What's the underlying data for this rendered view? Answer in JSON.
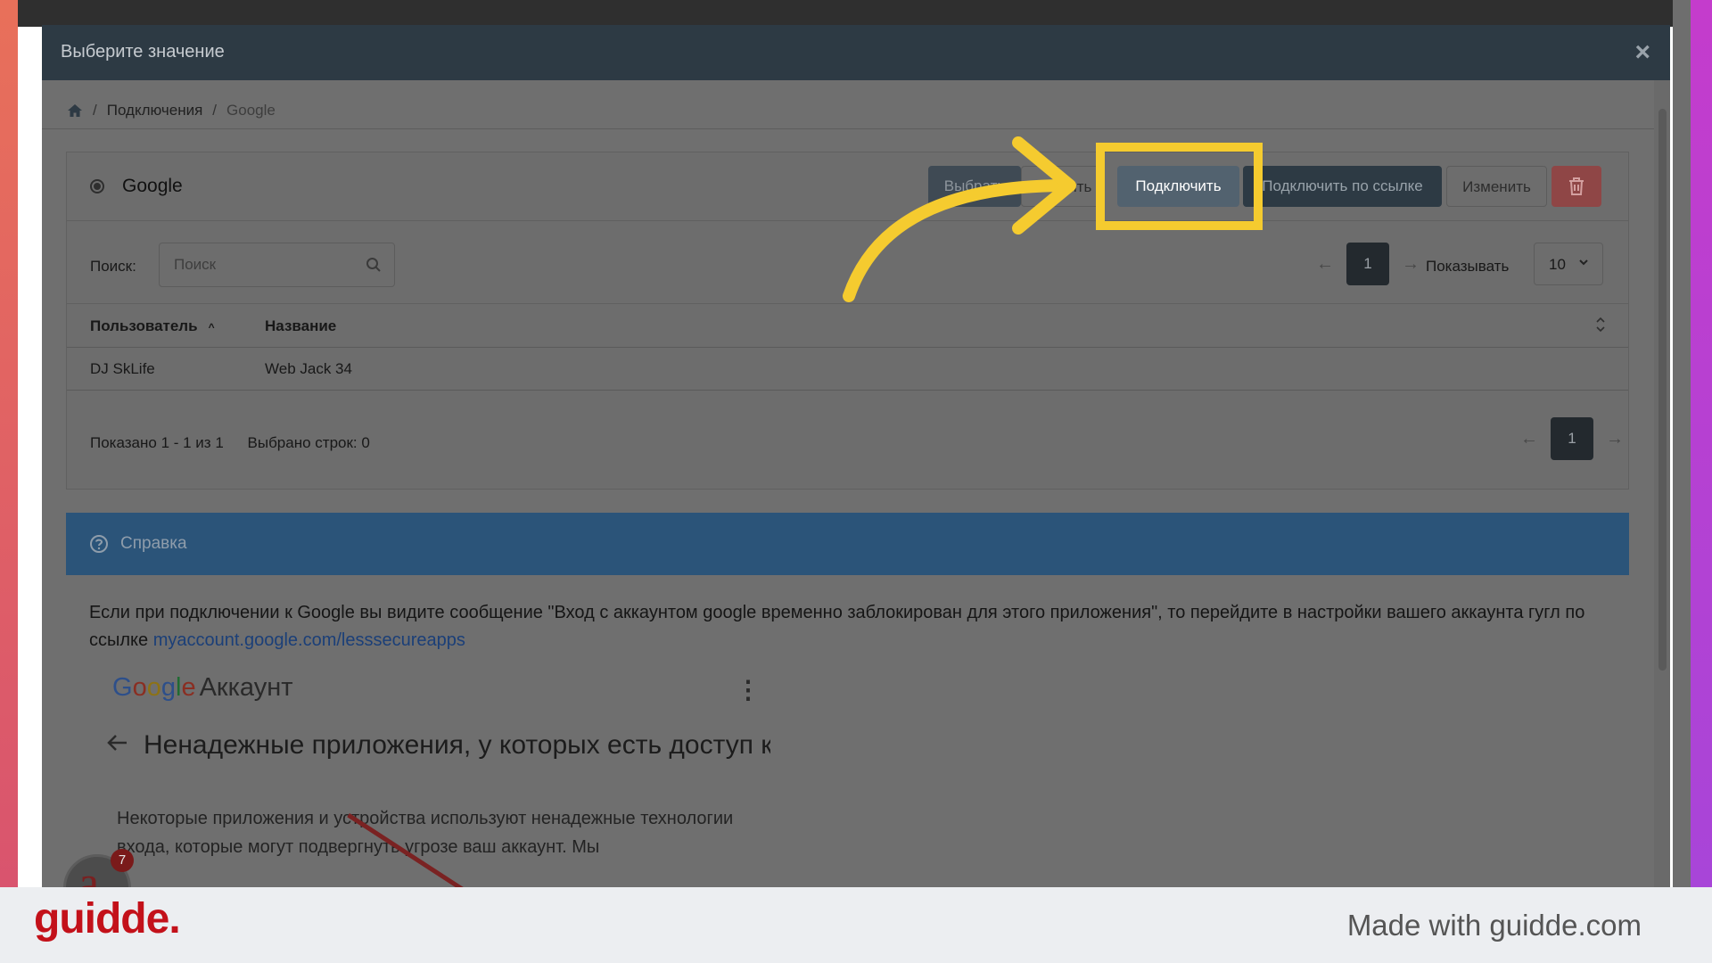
{
  "modal": {
    "title": "Выберите значение",
    "close": "×"
  },
  "breadcrumb": {
    "sep": "/",
    "items": [
      "Подключения",
      "Google"
    ]
  },
  "panel": {
    "title": "Google",
    "buttons": {
      "select": "Выбрать",
      "open": "Открыть",
      "connect": "Подключить",
      "connect_link": "Подключить по ссылке",
      "edit": "Изменить"
    },
    "search": {
      "label": "Поиск:",
      "placeholder": "Поиск"
    },
    "pagination": {
      "prev": "←",
      "page": "1",
      "next": "→"
    },
    "show": {
      "label": "Показывать",
      "value": "10"
    },
    "table": {
      "columns": [
        "Пользователь",
        "Название"
      ],
      "rows": [
        {
          "user": "DJ SkLife",
          "name": "Web Jack 34"
        }
      ]
    },
    "footer": {
      "shown": "Показано 1 - 1 из 1",
      "selected": "Выбрано строк: 0"
    }
  },
  "help": {
    "title": "Справка",
    "text": "Если при подключении к Google вы видите сообщение \"Вход с аккаунтом google временно заблокирован для этого приложения\", то перейдите в настройки вашего аккаунта гугл по ссылке ",
    "link": "myaccount.google.com/lesssecureapps",
    "screenshot": {
      "logo_letters": [
        "G",
        "o",
        "o",
        "g",
        "l",
        "e"
      ],
      "account": "Аккаунт",
      "menu": "⋮",
      "title": "Ненадежные приложения, у которых есть доступ к аккаунту",
      "desc": "Некоторые приложения и устройства используют ненадежные технологии входа, которые могут подвергнуть угрозе ваш аккаунт. Мы"
    }
  },
  "overlay": {
    "badge": "7",
    "avatar_letter": "a"
  },
  "footer": {
    "logo": "guidde.",
    "made_with": "Made with guidde.com"
  },
  "colors": {
    "highlight": "#f5cb2f",
    "brand": "#c3111a",
    "help_bar": "#2b5479"
  },
  "icons": [
    "home-icon",
    "search-icon",
    "trash-icon",
    "chevron-down-icon",
    "sort-icon",
    "help-circle-icon",
    "arrow-left-icon",
    "close-icon"
  ]
}
